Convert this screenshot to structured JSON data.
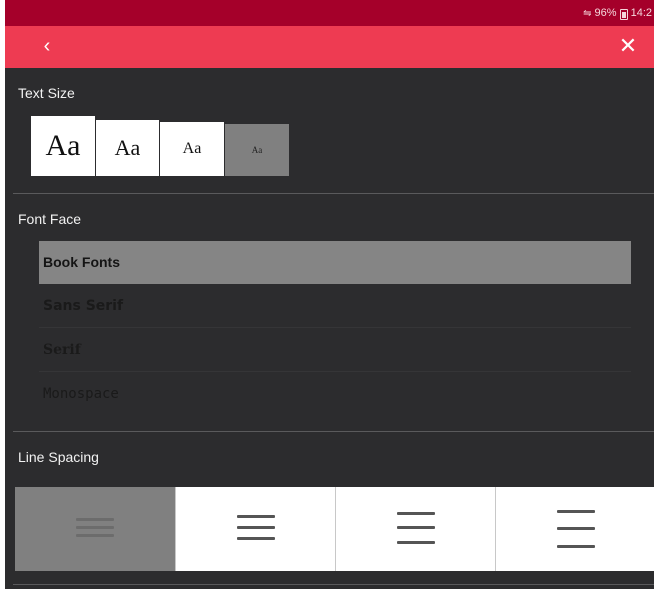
{
  "status": {
    "signal": "⇋",
    "battery": "96%",
    "time": "14:2"
  },
  "toolbar": {
    "back_icon": "chevron-left-icon",
    "close_icon": "close-icon"
  },
  "text_size": {
    "title": "Text Size",
    "options": [
      {
        "label": "Aa",
        "selected": false
      },
      {
        "label": "Aa",
        "selected": false
      },
      {
        "label": "Aa",
        "selected": false
      },
      {
        "label": "Aa",
        "selected": true
      }
    ]
  },
  "font_face": {
    "title": "Font Face",
    "options": [
      {
        "label": "Book Fonts",
        "selected": true
      },
      {
        "label": "Sans Serif",
        "selected": false
      },
      {
        "label": "Serif",
        "selected": false
      },
      {
        "label": "Monospace",
        "selected": false
      }
    ]
  },
  "line_spacing": {
    "title": "Line Spacing",
    "options": [
      {
        "name": "compact",
        "selected": true
      },
      {
        "name": "normal",
        "selected": false
      },
      {
        "name": "relaxed",
        "selected": false
      },
      {
        "name": "wide",
        "selected": false
      }
    ]
  },
  "colors": {
    "accent": "#ee3b52",
    "status_bar": "#a5002a",
    "panel": "#2c2c2e",
    "selected": "#808080"
  }
}
